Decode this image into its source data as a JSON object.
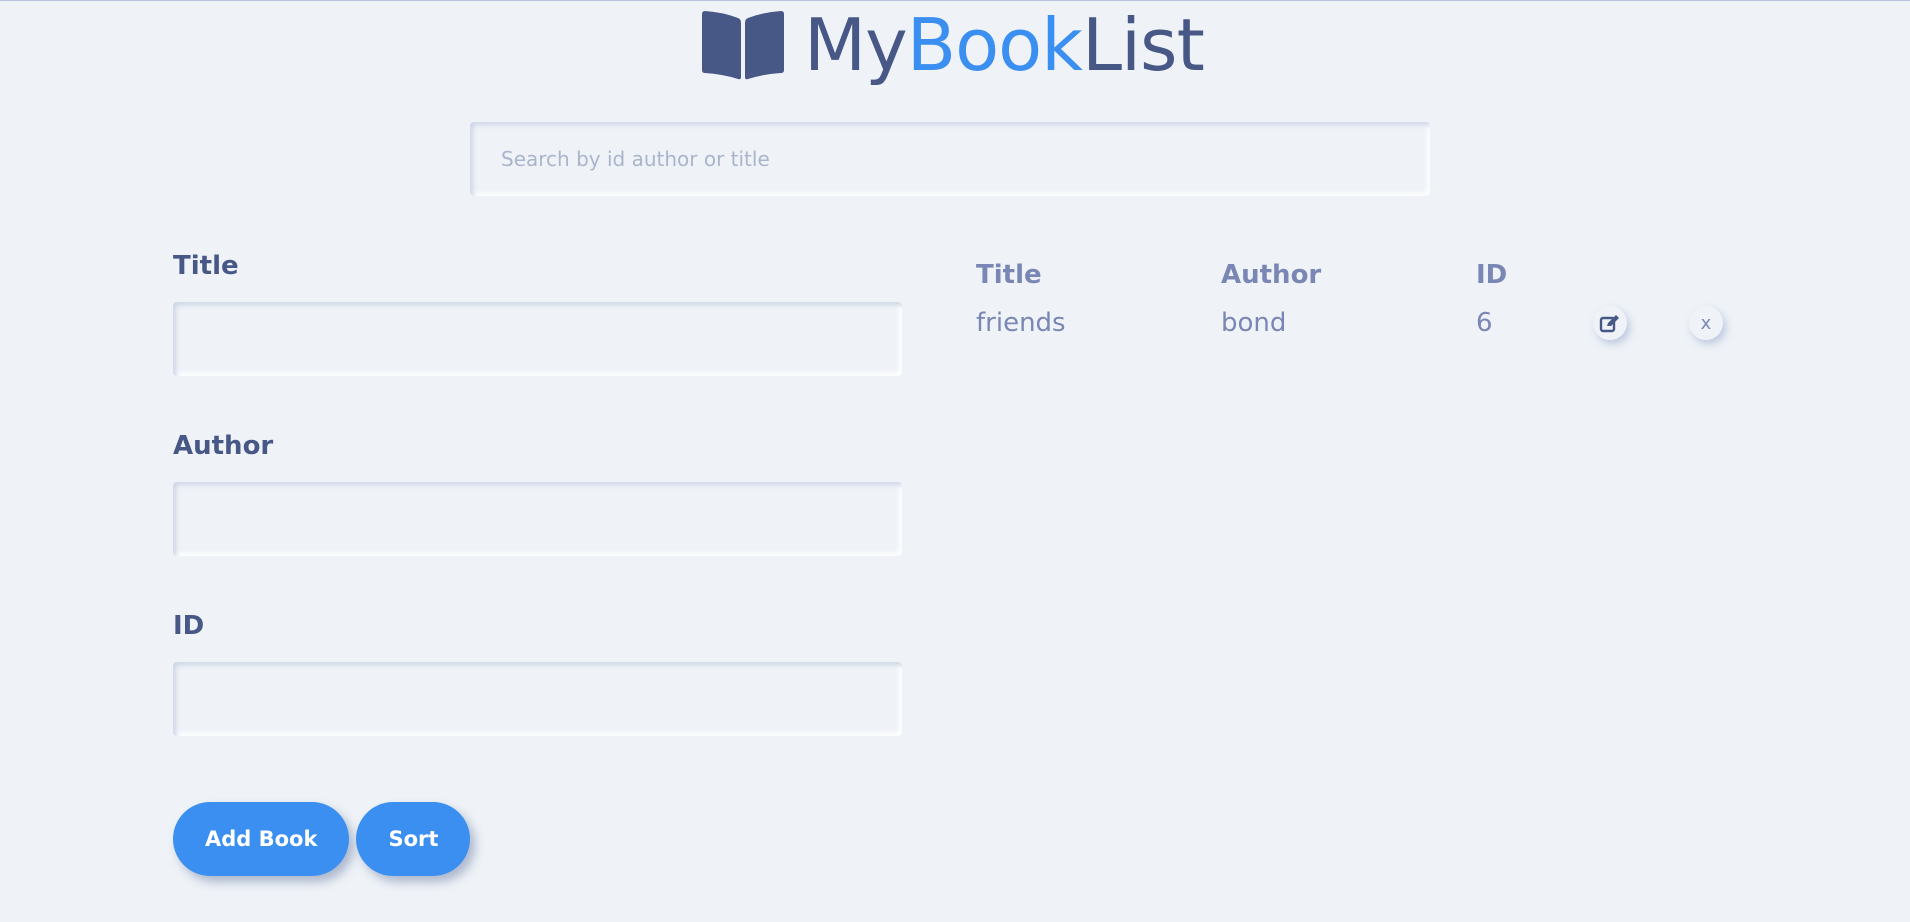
{
  "header": {
    "logo_icon": "open-book-icon",
    "title_part1": "My",
    "title_part2": "Book",
    "title_part3": "List"
  },
  "search": {
    "placeholder": "Search by id author or title",
    "value": ""
  },
  "form": {
    "title_label": "Title",
    "title_value": "",
    "author_label": "Author",
    "author_value": "",
    "id_label": "ID",
    "id_value": ""
  },
  "buttons": {
    "add_label": "Add Book",
    "sort_label": "Sort"
  },
  "table": {
    "headers": {
      "title": "Title",
      "author": "Author",
      "id": "ID"
    },
    "rows": [
      {
        "title": "friends",
        "author": "bond",
        "id": "6",
        "edit_icon": "edit-icon",
        "delete_label": "x"
      }
    ]
  },
  "colors": {
    "background": "#eff3f8",
    "primary": "#3a8ff0",
    "text_dark": "#475886",
    "text_muted": "#7a87b4"
  }
}
